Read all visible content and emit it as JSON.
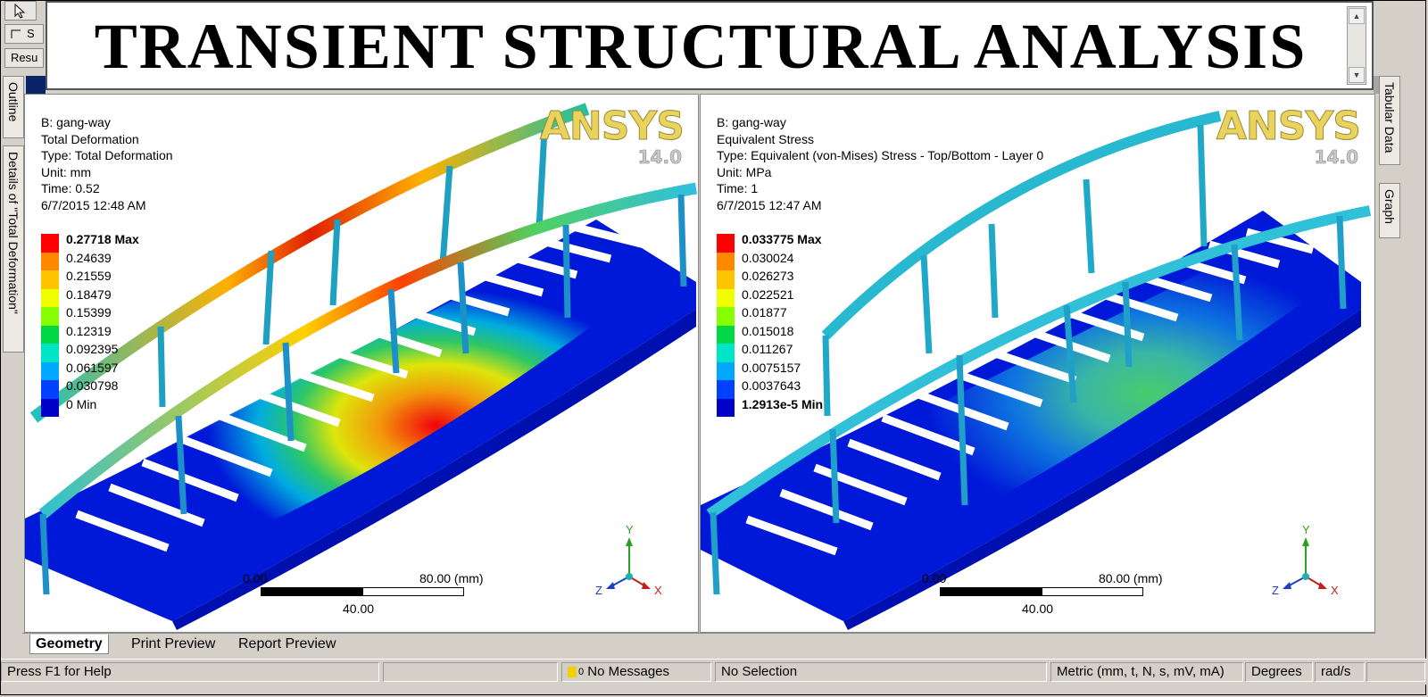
{
  "banner": {
    "title": "TRANSIENT STRUCTURAL ANALYSIS"
  },
  "toolbar": {
    "item_1": "S",
    "results_tab": "Resu"
  },
  "side_tabs_left": {
    "outline": "Outline",
    "details": "Details of \"Total Deformation\""
  },
  "side_tabs_right": {
    "tabular": "Tabular Data",
    "graph": "Graph"
  },
  "left_view": {
    "model": "B: gang-way",
    "result": "Total Deformation",
    "type": "Type: Total Deformation",
    "unit": "Unit: mm",
    "time": "Time: 0.52",
    "date": "6/7/2015 12:48 AM",
    "legend": [
      "0.27718 Max",
      "0.24639",
      "0.21559",
      "0.18479",
      "0.15399",
      "0.12319",
      "0.092395",
      "0.061597",
      "0.030798",
      "0 Min"
    ],
    "scale_start": "0.00",
    "scale_end": "80.00 (mm)",
    "scale_mid": "40.00"
  },
  "right_view": {
    "model": "B: gang-way",
    "result": "Equivalent Stress",
    "type": "Type: Equivalent (von-Mises) Stress - Top/Bottom - Layer 0",
    "unit": "Unit: MPa",
    "time": "Time: 1",
    "date": "6/7/2015 12:47 AM",
    "legend": [
      "0.033775 Max",
      "0.030024",
      "0.026273",
      "0.022521",
      "0.01877",
      "0.015018",
      "0.011267",
      "0.0075157",
      "0.0037643",
      "1.2913e-5 Min"
    ],
    "scale_start": "0.00",
    "scale_end": "80.00 (mm)",
    "scale_mid": "40.00"
  },
  "logo": {
    "brand": "ANSYS",
    "version": "14.0"
  },
  "axes": {
    "x": "X",
    "y": "Y",
    "z": "Z"
  },
  "legend_colors": [
    "#ff0000",
    "#ff8800",
    "#ffc400",
    "#f0ff00",
    "#88ff00",
    "#00d846",
    "#00e4c8",
    "#00a8ff",
    "#0040ff",
    "#0000c8"
  ],
  "bottom_tabs": {
    "geometry": "Geometry",
    "print_preview": "Print Preview",
    "report_preview": "Report Preview"
  },
  "status": {
    "help": "Press F1 for Help",
    "messages_count": "0",
    "messages": "No Messages",
    "selection": "No Selection",
    "units": "Metric (mm, t, N, s, mV, mA)",
    "angle": "Degrees",
    "rate": "rad/s"
  }
}
